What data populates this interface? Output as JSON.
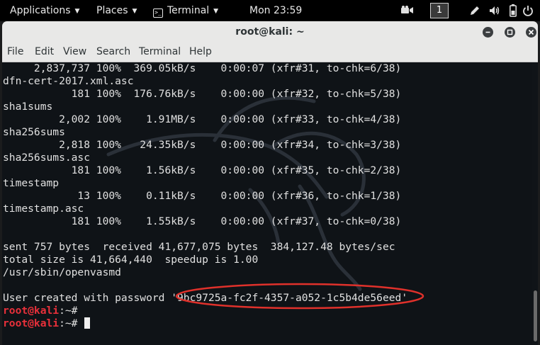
{
  "topbar": {
    "applications": "Applications",
    "places": "Places",
    "terminal": "Terminal",
    "clock": "Mon 23:59",
    "workspace": "1",
    "icons": [
      "video-icon",
      "pencil-icon",
      "audio-icon",
      "battery-icon",
      "power-icon"
    ]
  },
  "window": {
    "title": "root@kali: ~",
    "controls": [
      "minimize",
      "maximize",
      "close"
    ]
  },
  "menu": [
    "File",
    "Edit",
    "View",
    "Search",
    "Terminal",
    "Help"
  ],
  "terminal": {
    "lines": [
      "     2,837,737 100%  369.05kB/s    0:00:07 (xfr#31, to-chk=6/38)",
      "dfn-cert-2017.xml.asc",
      "           181 100%  176.76kB/s    0:00:00 (xfr#32, to-chk=5/38)",
      "sha1sums",
      "         2,002 100%    1.91MB/s    0:00:00 (xfr#33, to-chk=4/38)",
      "sha256sums",
      "         2,818 100%   24.35kB/s    0:00:00 (xfr#34, to-chk=3/38)",
      "sha256sums.asc",
      "           181 100%    1.56kB/s    0:00:00 (xfr#35, to-chk=2/38)",
      "timestamp",
      "            13 100%    0.11kB/s    0:00:00 (xfr#36, to-chk=1/38)",
      "timestamp.asc",
      "           181 100%    1.55kB/s    0:00:00 (xfr#37, to-chk=0/38)",
      "",
      "sent 757 bytes  received 41,677,075 bytes  384,127.48 bytes/sec",
      "total size is 41,664,440  speedup is 1.00",
      "/usr/sbin/openvasmd",
      "",
      "User created with password '9bc9725a-fc2f-4357-a052-1c5b4de56eed'"
    ],
    "prompt_user": "root@kali",
    "prompt_rest": ":~#",
    "colors": {
      "background": "#0f1317",
      "text": "#e0e0e0",
      "prompt": "#e8303a",
      "highlight": "#e0312b"
    }
  }
}
